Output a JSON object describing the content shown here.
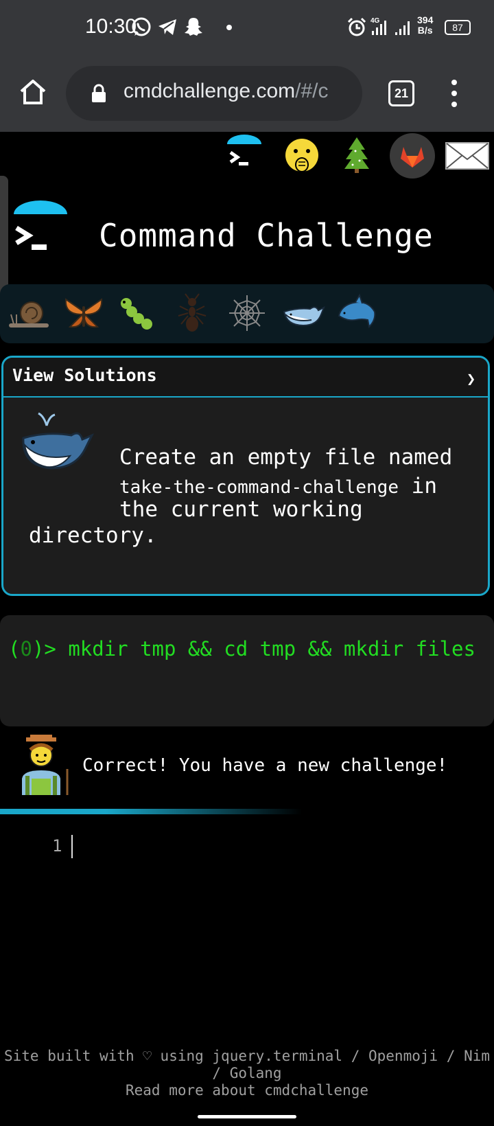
{
  "status_bar": {
    "time": "10:30",
    "network": "4G",
    "speed_value": "394",
    "speed_unit": "B/s",
    "battery": "87"
  },
  "browser": {
    "url_main": "cmdchallenge.com",
    "url_rest": "/#/c",
    "tab_count": "21"
  },
  "nav_icons": [
    "terminal-icon",
    "shushing-face-icon",
    "tree-icon",
    "gitlab-icon",
    "mail-icon"
  ],
  "header": {
    "title": "Command Challenge"
  },
  "levels": [
    "snail",
    "butterfly",
    "caterpillar",
    "ant",
    "spider-web",
    "whale",
    "dolphin"
  ],
  "challenge": {
    "solutions_label": "View Solutions",
    "chevron": "❯",
    "line1": "Create an empty file named",
    "filename": "take-the-command-challenge",
    "line2_suffix": " in",
    "line3": "the current working",
    "line4": "directory."
  },
  "terminal": {
    "prompt_open": "(",
    "exit_code": "0",
    "prompt_close": ")> ",
    "command": "mkdir tmp && cd tmp && mkdir files"
  },
  "result": {
    "message": "Correct! You have a new challenge!"
  },
  "editor": {
    "line_number": "1"
  },
  "footer": {
    "line1": "Site built with ♡ using jquery.terminal / Openmoji / Nim",
    "line2": "/ Golang",
    "line3": "Read more about cmdchallenge"
  },
  "colors": {
    "accent": "#1aa7c9",
    "terminal_green": "#22dd22",
    "background": "#000000"
  }
}
